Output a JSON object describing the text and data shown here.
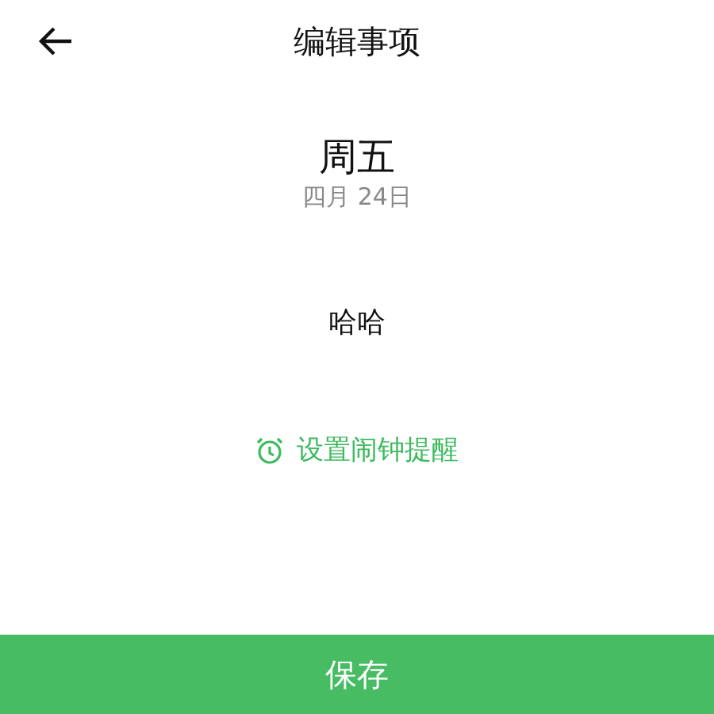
{
  "header": {
    "title": "编辑事项"
  },
  "date": {
    "weekday": "周五",
    "date": "四月 24日"
  },
  "item": {
    "text": "哈哈"
  },
  "alarm": {
    "label": "设置闹钟提醒"
  },
  "save_button": {
    "label": "保存"
  }
}
